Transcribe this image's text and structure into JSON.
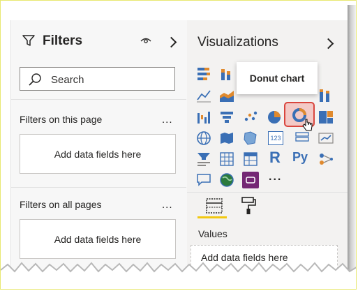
{
  "filters": {
    "title": "Filters",
    "search_placeholder": "Search",
    "on_this_page_label": "Filters on this page",
    "on_all_pages_label": "Filters on all pages",
    "more_label": "...",
    "drop_text": "Add data fields here"
  },
  "visualizations": {
    "title": "Visualizations",
    "tooltip": "Donut chart",
    "more_visuals": "...",
    "r_visual_label": "R",
    "python_visual_label": "Py",
    "table_icon_label": "123",
    "values_label": "Values",
    "drop_text": "Add data fields here"
  },
  "colors": {
    "accent_yellow": "#f2c811",
    "highlight_red": "#d9453d",
    "icon_blue": "#3a6fb5",
    "icon_orange": "#e08a2e"
  }
}
